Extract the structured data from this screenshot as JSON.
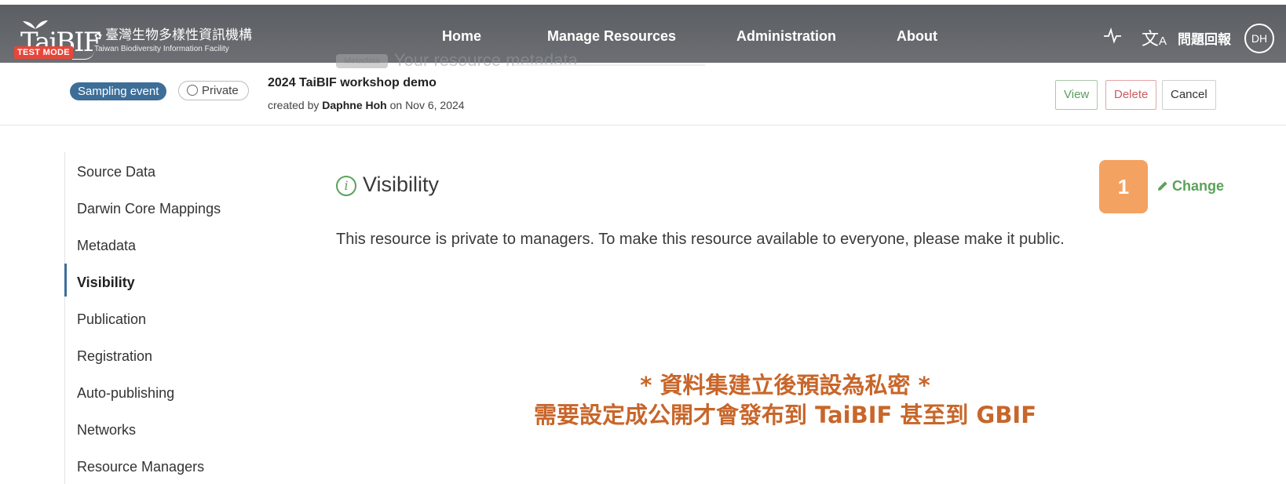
{
  "navbar": {
    "logo_zh": "臺灣生物多樣性資訊機構",
    "logo_en": "Taiwan Biodiversity Information Facility",
    "logo_mark": "TaiBIF",
    "test_badge": "TEST MODE",
    "ghost_tag": "Metadata",
    "ghost_text": "Your resource metadata",
    "links": [
      "Home",
      "Manage Resources",
      "Administration",
      "About"
    ],
    "activity_icon": "activity-icon",
    "translate_icon": "translate-icon",
    "feedback_label": "問題回報",
    "user_initials": "DH"
  },
  "resource": {
    "type_badge": "Sampling event",
    "visibility_badge": "Private",
    "title": "2024 TaiBIF workshop demo",
    "created_prefix": "created by",
    "created_by": "Daphne Hoh",
    "created_on": "on Nov 6, 2024",
    "buttons": {
      "view": "View",
      "delete": "Delete",
      "cancel": "Cancel"
    }
  },
  "sidebar": {
    "items": [
      {
        "label": "Source Data"
      },
      {
        "label": "Darwin Core Mappings"
      },
      {
        "label": "Metadata"
      },
      {
        "label": "Visibility",
        "active": true
      },
      {
        "label": "Publication"
      },
      {
        "label": "Registration"
      },
      {
        "label": "Auto-publishing"
      },
      {
        "label": "Networks"
      },
      {
        "label": "Resource Managers"
      }
    ]
  },
  "main": {
    "section_title": "Visibility",
    "info_glyph": "i",
    "step_number": "1",
    "change_label": "Change",
    "description": "This resource is private to managers. To make this resource available to everyone, please make it public.",
    "note_line1": "* 資料集建立後預設為私密 *",
    "note_line2": "需要設定成公開才會發布到 TaiBIF 甚至到 GBIF"
  },
  "colors": {
    "navbar": "#65686c",
    "accent_blue": "#3d6e98",
    "accent_green": "#5aa25a",
    "danger": "#c95c63",
    "step_badge": "#f4a261",
    "note_text": "#c8662a",
    "test_badge": "#e8463a"
  }
}
